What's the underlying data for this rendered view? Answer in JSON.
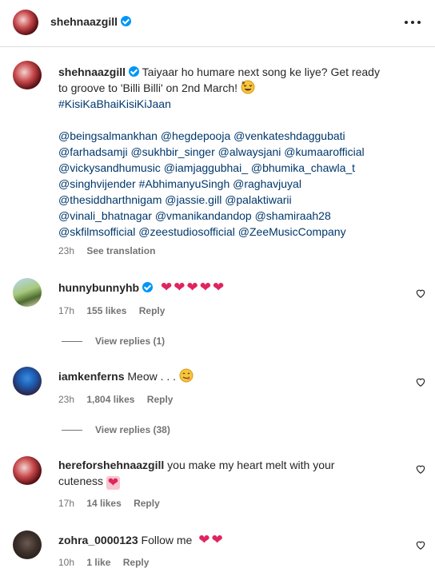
{
  "header": {
    "username": "shehnaazgill",
    "more_icon": "more-horizontal-icon"
  },
  "caption": {
    "username": "shehnaazgill",
    "text_line1": "Taiyaar ho humare next song ke liye? Get ready",
    "text_line2": "to groove to 'Billi Billi' on 2nd March!",
    "hashtag": "#KisiKaBhaiKisiKiJaan",
    "mentions": [
      "@beingsalmankhan @hegdepooja @venkateshdaggubati",
      "@farhadsamji @sukhbir_singer @alwaysjani @kumaarofficial",
      "@vickysandhumusic @iamjaggubhai_ @bhumika_chawla_t",
      "@singhvijender #AbhimanyuSingh @raghavjuyal",
      "@thesiddharthnigam @jassie.gill @palaktiwarii",
      "@vinali_bhatnagar @vmanikandandop @shamiraah28",
      "@skfilmsofficial @zeestudiosofficial @ZeeMusicCompany"
    ],
    "time": "23h",
    "see_translation": "See translation"
  },
  "comments": [
    {
      "username": "hunnybunnyhb",
      "verified": true,
      "text": "",
      "time": "17h",
      "likes": "155 likes",
      "reply": "Reply",
      "view_replies": "View replies (1)"
    },
    {
      "username": "iamkenferns",
      "verified": false,
      "text": "Meow . . .",
      "time": "23h",
      "likes": "1,804 likes",
      "reply": "Reply",
      "view_replies": "View replies (38)"
    },
    {
      "username": "hereforshehnaazgill",
      "verified": false,
      "text_line1": "you make my heart melt with your",
      "text_line2": "cuteness",
      "time": "17h",
      "likes": "14 likes",
      "reply": "Reply"
    },
    {
      "username": "zohra_0000123",
      "verified": false,
      "text": "Follow me",
      "time": "10h",
      "likes": "1 like",
      "reply": "Reply"
    }
  ],
  "colors": {
    "heart_red": "#e0245e",
    "verified_blue": "#0095f6",
    "link_blue": "#00376b",
    "muted": "#737373"
  }
}
